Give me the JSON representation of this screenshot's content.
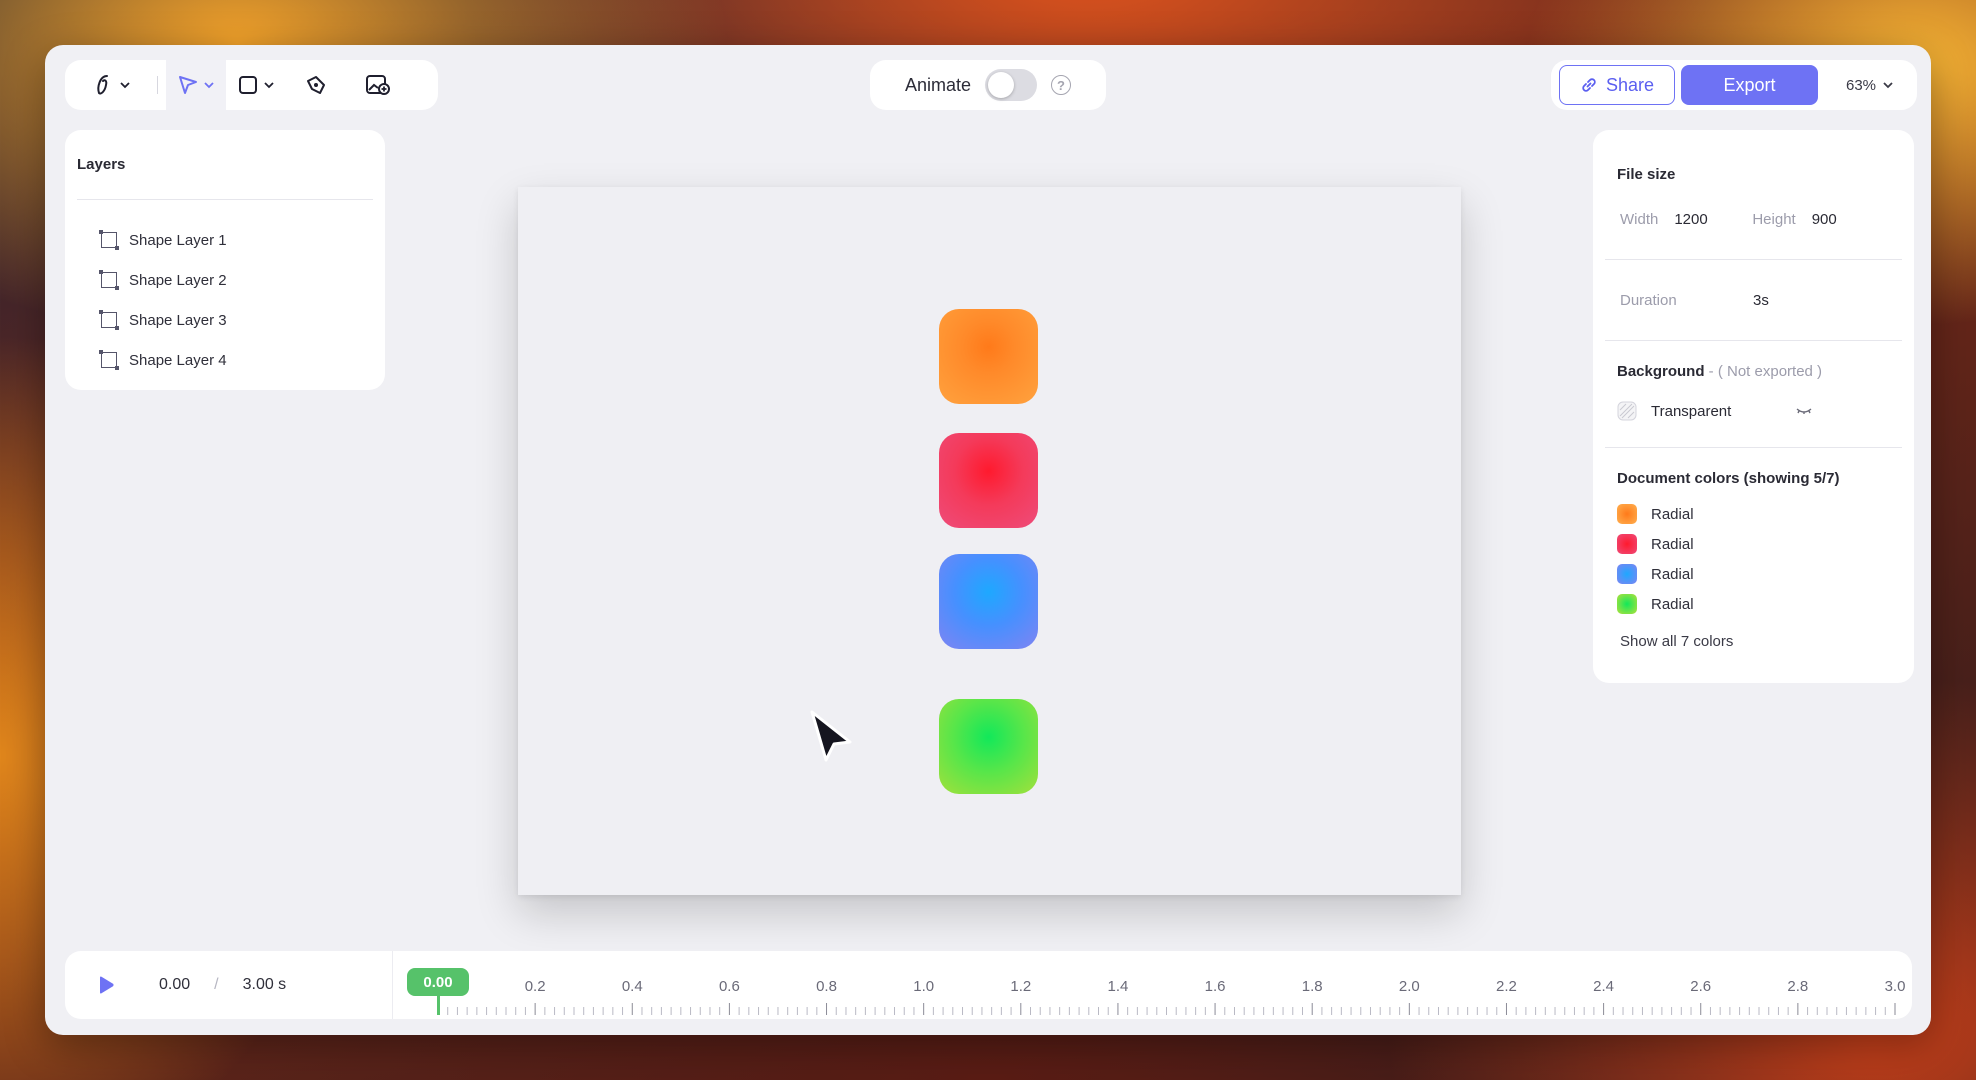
{
  "toolbar": {
    "tools": [
      "pen-tool",
      "select-tool",
      "shape-tool",
      "pencil-tool",
      "image-tool"
    ]
  },
  "animate": {
    "label": "Animate",
    "enabled": false,
    "help": "?"
  },
  "actions": {
    "share_label": "Share",
    "export_label": "Export",
    "zoom": "63%"
  },
  "layers": {
    "title": "Layers",
    "items": [
      {
        "label": "Shape Layer 1"
      },
      {
        "label": "Shape Layer 2"
      },
      {
        "label": "Shape Layer 3"
      },
      {
        "label": "Shape Layer 4"
      }
    ]
  },
  "canvas": {
    "shapes": [
      {
        "name": "orange",
        "color": "#ff8a2a"
      },
      {
        "name": "red",
        "color": "#f43a5a"
      },
      {
        "name": "blue",
        "color": "#4690ff"
      },
      {
        "name": "green",
        "color": "#55e64a"
      }
    ]
  },
  "properties": {
    "file_size": {
      "title": "File size",
      "width_label": "Width",
      "width": "1200",
      "height_label": "Height",
      "height": "900"
    },
    "duration": {
      "label": "Duration",
      "value": "3s"
    },
    "background": {
      "title": "Background",
      "note": " - ( Not exported )",
      "value": "Transparent"
    },
    "document_colors": {
      "title": "Document colors (showing 5/7)",
      "items": [
        {
          "label": "Radial",
          "color": "#ff8a2a"
        },
        {
          "label": "Radial",
          "color": "#f43a5a"
        },
        {
          "label": "Radial",
          "color": "#4690ff"
        },
        {
          "label": "Radial",
          "color": "#55e64a"
        }
      ],
      "show_all": "Show all 7 colors"
    }
  },
  "timeline": {
    "current": "0.00",
    "separator": "/",
    "total": "3.00 s",
    "playhead": "0.00",
    "ticks": [
      "0.2",
      "0.4",
      "0.6",
      "0.8",
      "1.0",
      "1.2",
      "1.4",
      "1.6",
      "1.8",
      "2.0",
      "2.2",
      "2.4",
      "2.6",
      "2.8",
      "3.0"
    ]
  },
  "colors": {
    "accent": "#6e72f4",
    "playhead": "#56c26a"
  }
}
